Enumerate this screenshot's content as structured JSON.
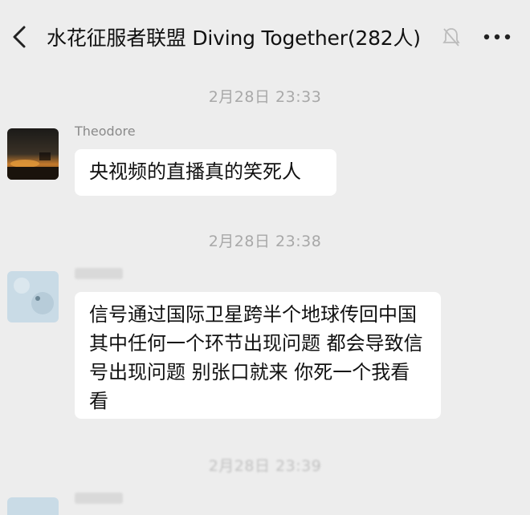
{
  "header": {
    "title": "水花征服者联盟 Diving Together(282人)"
  },
  "messages": [
    {
      "time": "2月28日 23:33",
      "sender": "Theodore",
      "text": "央视频的直播真的笑死人"
    },
    {
      "time": "2月28日 23:38",
      "sender": "",
      "text": "信号通过国际卫星跨半个地球传回中国 其中任何一个环节出现问题 都会导致信号出现问题 别张口就来 你死一个我看看"
    },
    {
      "time": "2月28日 23:39",
      "sender": "",
      "text": ""
    }
  ],
  "colors": {
    "background": "#ededed",
    "bubble": "#ffffff",
    "timestamp": "#a8a8a8"
  }
}
